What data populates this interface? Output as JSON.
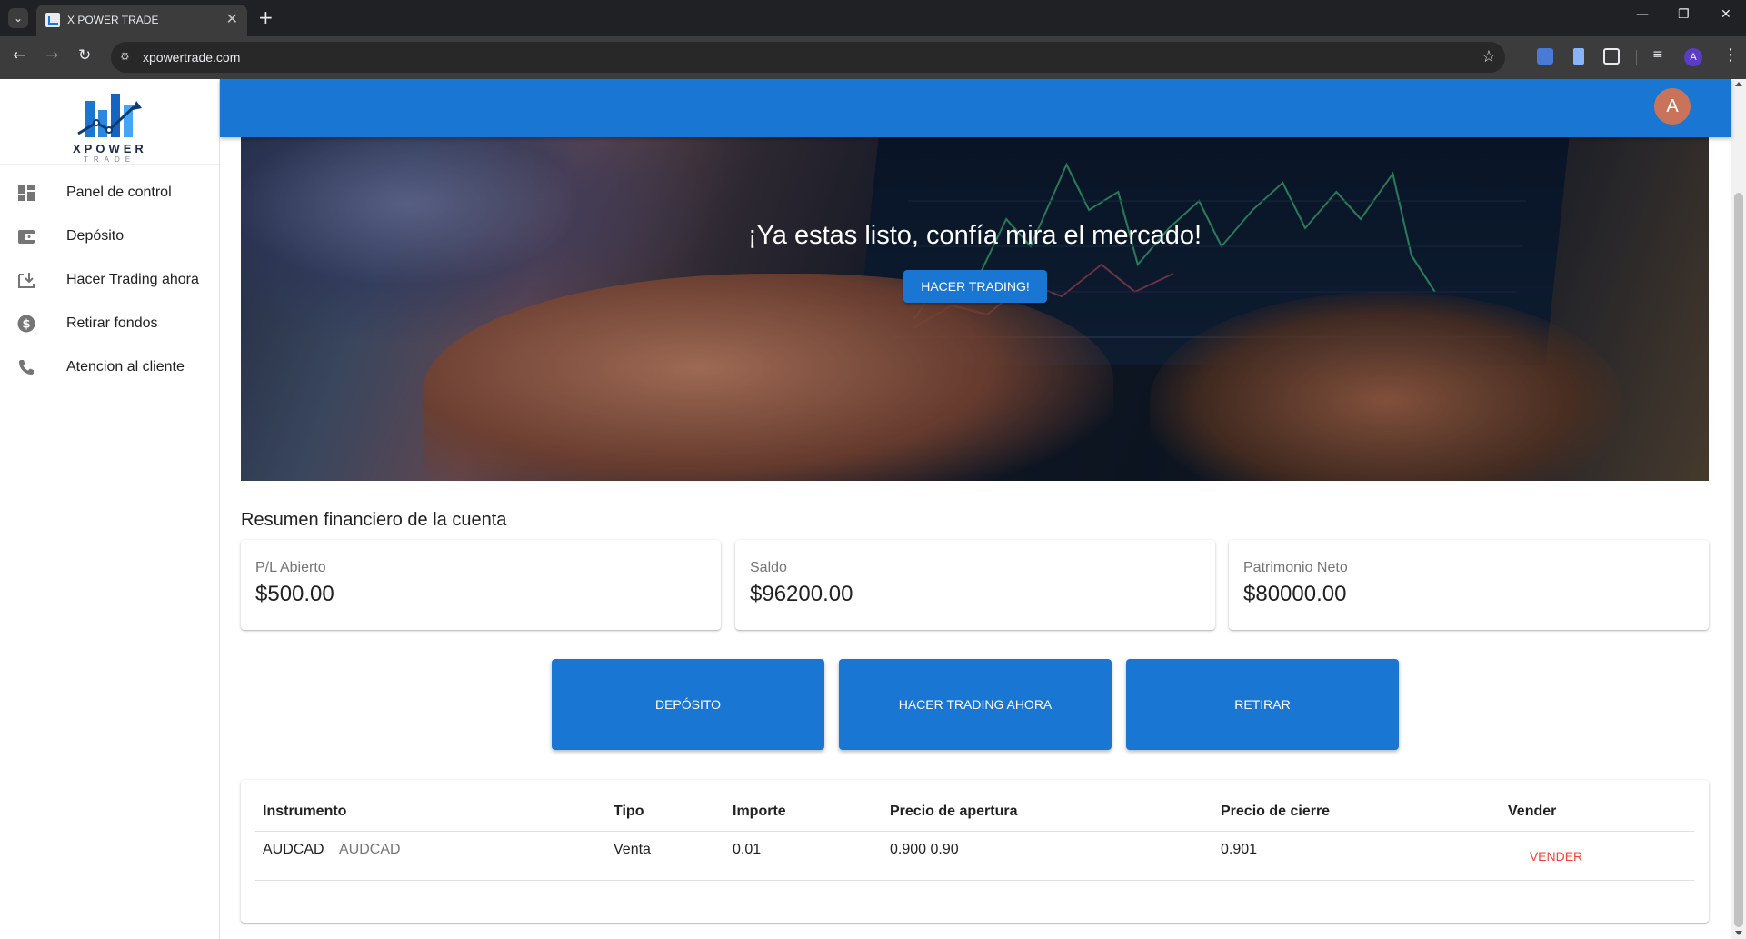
{
  "browser": {
    "tab_title": "X POWER TRADE",
    "url": "xpowertrade.com",
    "profile_initial": "A"
  },
  "brand": {
    "logo_text": "XPOWER",
    "logo_sub": "TRADE",
    "primary_color": "#1976d2",
    "danger_color": "#f44336"
  },
  "sidebar": {
    "items": [
      {
        "label": "Panel de control",
        "icon": "dashboard-icon"
      },
      {
        "label": "Depósito",
        "icon": "wallet-icon"
      },
      {
        "label": "Hacer Trading ahora",
        "icon": "download-icon"
      },
      {
        "label": "Retirar fondos",
        "icon": "dollar-icon"
      },
      {
        "label": "Atencion al cliente",
        "icon": "phone-icon"
      }
    ]
  },
  "appbar": {
    "avatar_initial": "A"
  },
  "hero": {
    "title": "¡Ya estas listo, confía mira el mercado!",
    "button": "HACER TRADING!"
  },
  "summary": {
    "title": "Resumen financiero de la cuenta",
    "cards": [
      {
        "label": "P/L Abierto",
        "value": "$500.00"
      },
      {
        "label": "Saldo",
        "value": "$96200.00"
      },
      {
        "label": "Patrimonio Neto",
        "value": "$80000.00"
      }
    ]
  },
  "actions": {
    "deposit": "DEPÓSITO",
    "trade": "HACER TRADING AHORA",
    "withdraw": "RETIRAR"
  },
  "table": {
    "headers": [
      "Instrumento",
      "Tipo",
      "Importe",
      "Precio de apertura",
      "Precio de cierre",
      "Vender"
    ],
    "rows": [
      {
        "instrument": "AUDCAD",
        "instrument_sub": "AUDCAD",
        "type": "Venta",
        "amount": "0.01",
        "open_price": "0.900 0.90",
        "close_price": "0.901",
        "sell": "VENDER"
      }
    ]
  }
}
